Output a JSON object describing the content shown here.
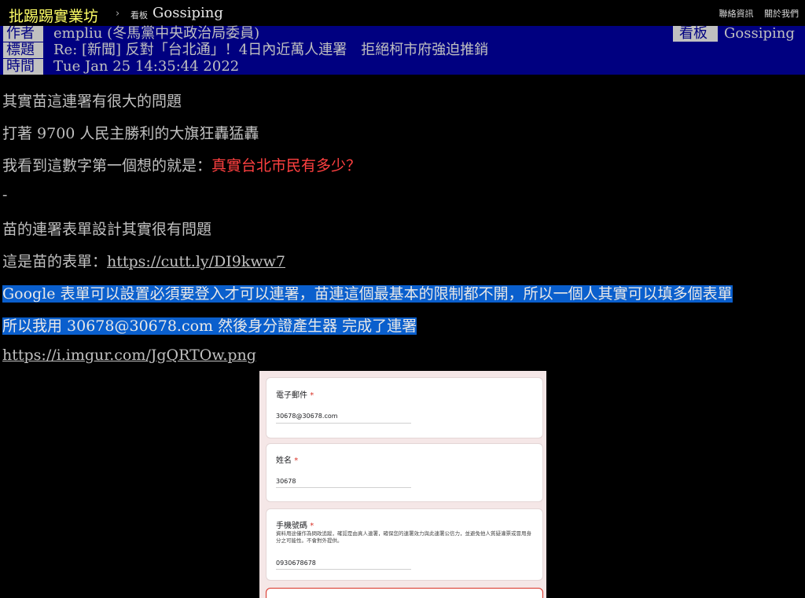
{
  "nav": {
    "site_name": "批踢踢實業坊",
    "separator": "›",
    "board_label": "看板",
    "board_name": "Gossiping",
    "links": [
      "聯絡資訊",
      "關於我們"
    ]
  },
  "meta": {
    "author_tag": "作者",
    "author": "empliu (冬馬黨中央政治局委員)",
    "board_tag": "看板",
    "board": "Gossiping",
    "title_tag": "標題",
    "title": "Re: [新聞] 反對「台北通」！4日內近萬人連署　拒絕柯市府強迫推銷",
    "time_tag": "時間",
    "time": "Tue Jan 25 14:35:44 2022"
  },
  "body": {
    "line1": "其實苗這連署有很大的問題",
    "line2": "打著 9700 人民主勝利的大旗狂轟猛轟",
    "line3_prefix": "我看到這數字第一個想的就是：",
    "line3_red": "真實台北市民有多少？",
    "line4": "-",
    "line5": "苗的連署表單設計其實很有問題",
    "line6_prefix": "這是苗的表單：",
    "line6_link": "https://cutt.ly/DI9kww7",
    "line7": "Google 表單可以設置必須要登入才可以連署，苗連這個最基本的限制都不開，所以一個人其實可以填多個表單",
    "line8": "所以我用 30678@30678.com 然後身分證產生器 完成了連署",
    "line9_link": "https://i.imgur.com/JgQRTOw.png"
  },
  "form_image": {
    "q1_label": "電子郵件",
    "q1_value": "30678@30678.com",
    "q2_label": "姓名",
    "q2_value": "30678",
    "q3_label": "手機號碼",
    "q3_desc": "資料用途僅作為問政追蹤，確認是由真人連署，確保您的連署效力與此連署公信力，並避免他人質疑灌票或冒用身分之可能性。不會對外提供。",
    "q3_value": "0930678678",
    "required_mark": "*"
  },
  "colors": {
    "header_bg": "#000080",
    "tag_bg": "#c0c0c0",
    "site_name": "#ffff66",
    "highlight": "#0a5fcd",
    "red_text": "#ff4040"
  }
}
